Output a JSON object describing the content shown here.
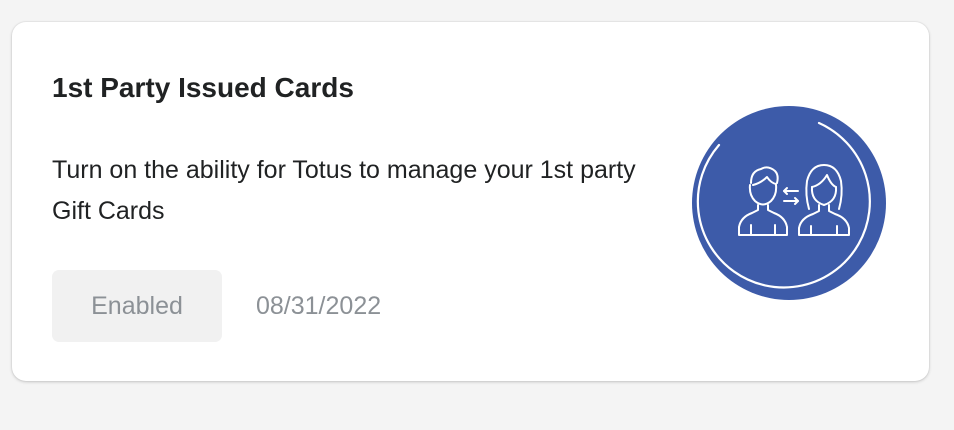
{
  "card": {
    "title": "1st Party Issued Cards",
    "description": "Turn on the ability for Totus to manage your 1st party Gift Cards",
    "status_button_label": "Enabled",
    "date": "08/31/2022",
    "illustration_icon": "people-exchange-icon"
  },
  "colors": {
    "page_background": "#f4f4f4",
    "card_background": "#ffffff",
    "illustration_circle": "#3d5ba9",
    "illustration_stroke": "#ffffff",
    "muted_text": "#8c9196",
    "title_text": "#202223",
    "disabled_button": "#f1f1f1"
  }
}
